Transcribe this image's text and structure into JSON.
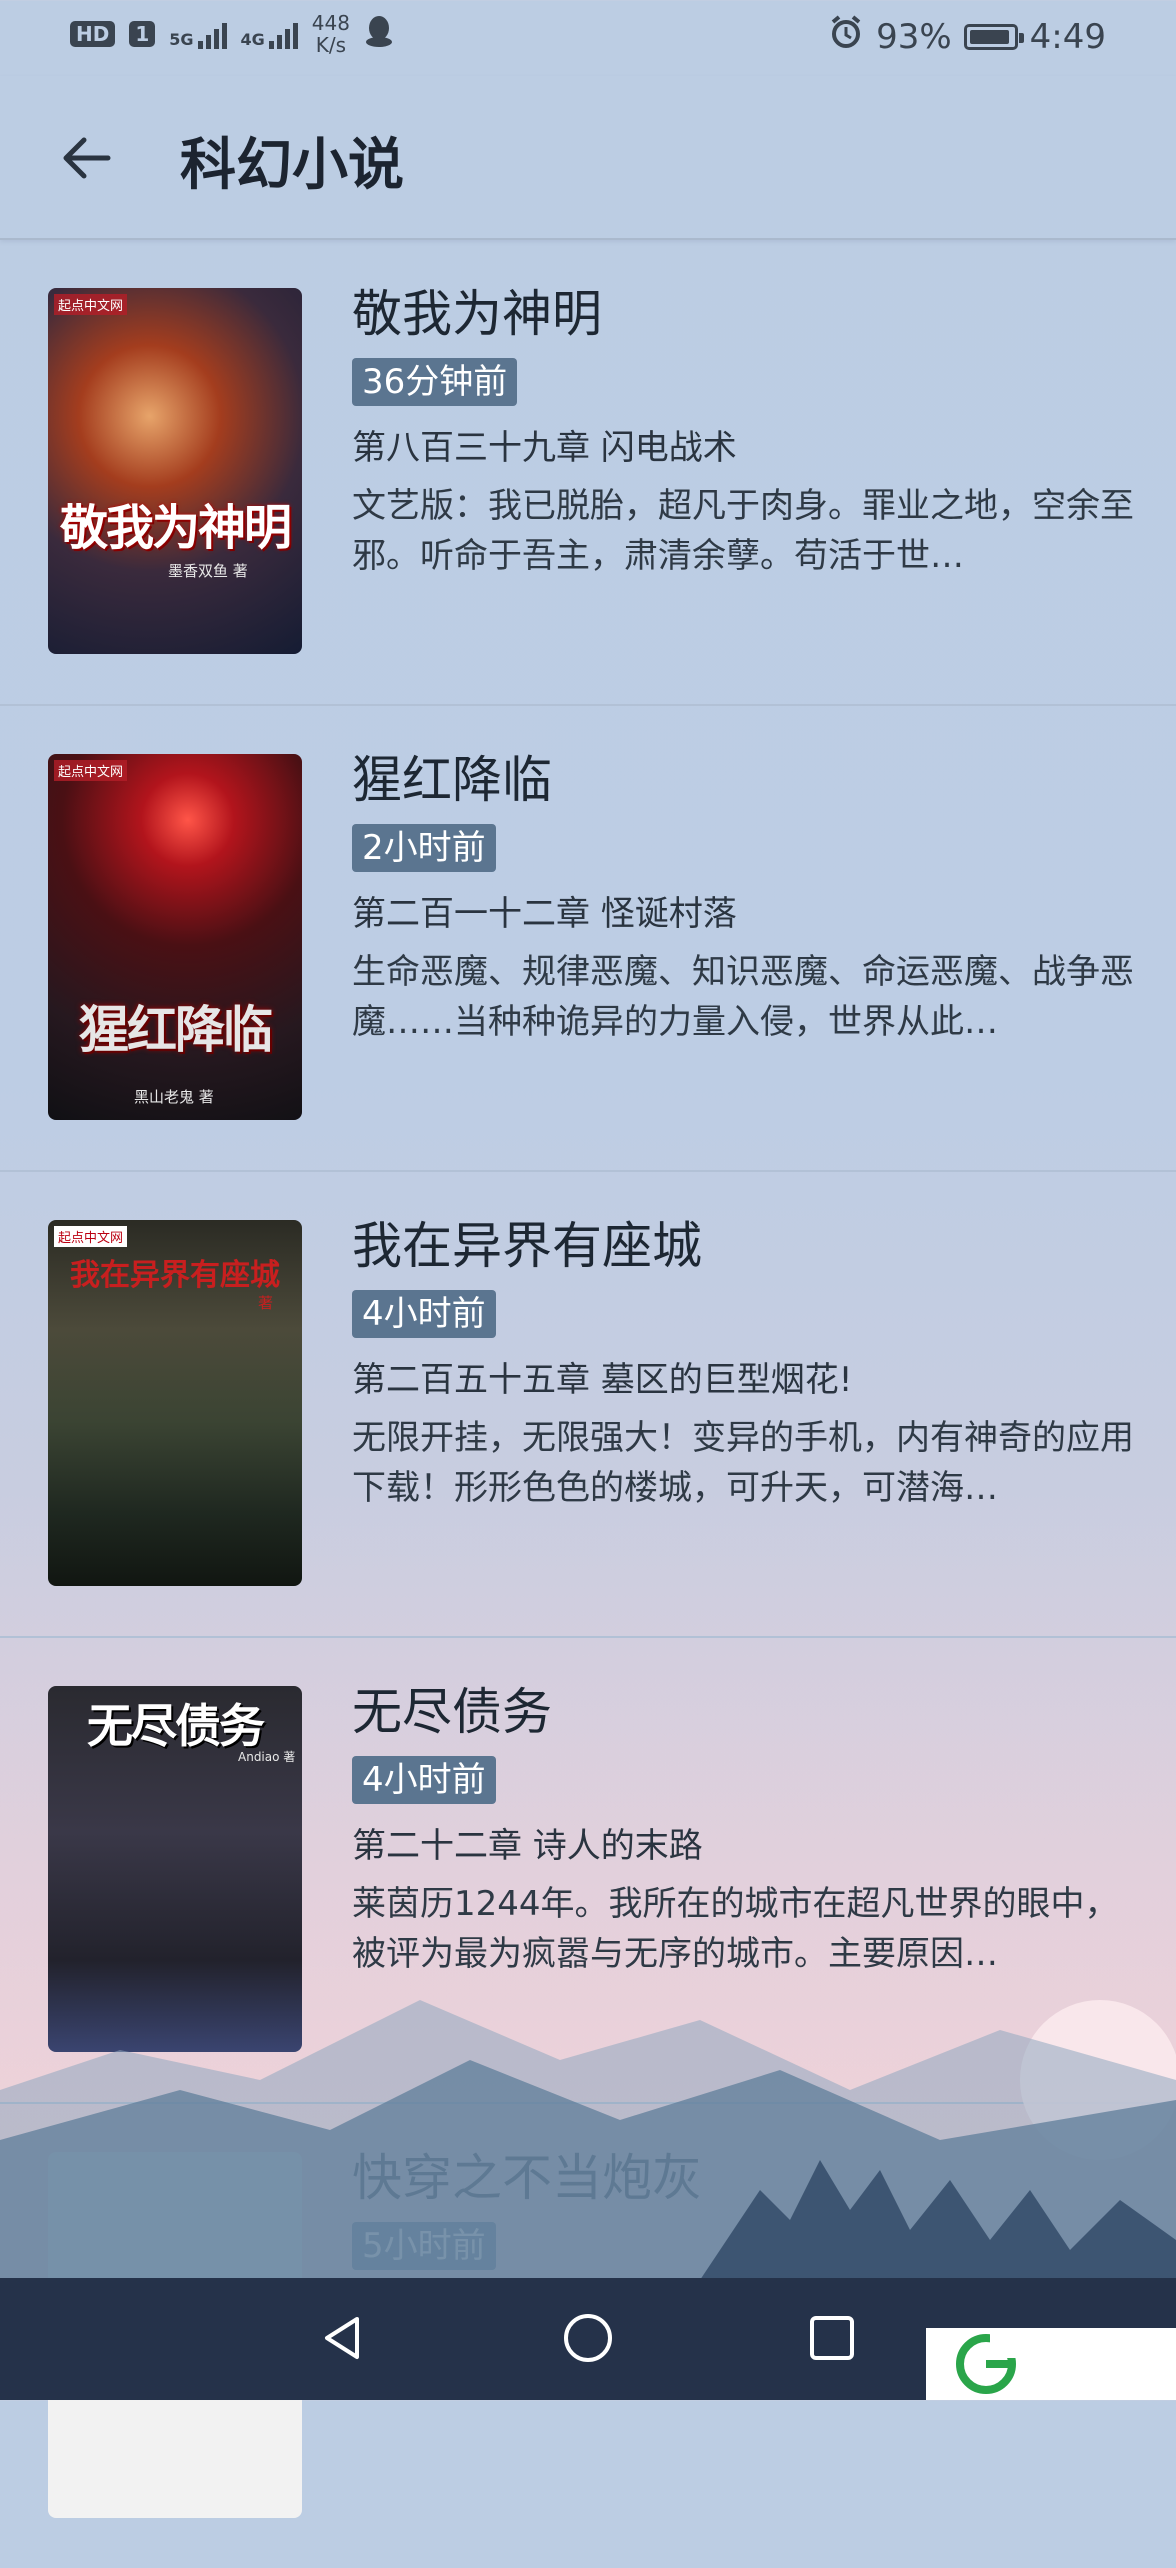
{
  "status": {
    "hd": "HD",
    "sim": "1",
    "sig1_label": "5G",
    "sig2_label": "4G",
    "net_speed": "448",
    "net_unit": "K/s",
    "battery": "93%",
    "battery_level": 0.93,
    "time": "4:49"
  },
  "header": {
    "title": "科幻小说",
    "back_icon": "back-arrow-icon"
  },
  "books": [
    {
      "name": "敬我为神明",
      "time": "36分钟前",
      "chapter": "第八百三十九章 闪电战术",
      "desc": "文艺版：我已脱胎，超凡于肉身。罪业之地，空余至邪。听命于吾主，肃清余孽。苟活于世…",
      "cover_title": "敬我为神明",
      "cover_author": "墨香双鱼 著",
      "cover_pub": "起点中文网"
    },
    {
      "name": "猩红降临",
      "time": "2小时前",
      "chapter": "第二百一十二章 怪诞村落",
      "desc": "生命恶魔、规律恶魔、知识恶魔、命运恶魔、战争恶魔……当种种诡异的力量入侵，世界从此…",
      "cover_title": "猩红降临",
      "cover_author": "黑山老鬼 著",
      "cover_pub": "起点中文网"
    },
    {
      "name": "我在异界有座城",
      "time": "4小时前",
      "chapter": "第二百五十五章 墓区的巨型烟花!",
      "desc": "无限开挂，无限强大！变异的手机，内有神奇的应用下载！形形色色的楼城，可升天，可潜海…",
      "cover_title": "我在异界有座城",
      "cover_author": "著",
      "cover_pub": "起点中文网"
    },
    {
      "name": "无尽债务",
      "time": "4小时前",
      "chapter": "第二十二章 诗人的末路",
      "desc": "莱茵历1244年。我所在的城市在超凡世界的眼中，被评为最为疯嚣与无序的城市。主要原因…",
      "cover_title": "无尽债务",
      "cover_author": "Andiao 著",
      "cover_pub": ""
    },
    {
      "name": "快穿之不当炮灰",
      "time": "5小时前",
      "chapter": "",
      "desc": "",
      "cover_title": "",
      "cover_author": "",
      "cover_pub": ""
    }
  ],
  "nav": {
    "back": "nav-back-icon",
    "home": "nav-home-icon",
    "recents": "nav-recents-icon"
  },
  "colors": {
    "badge": "#5b7590",
    "navbar": "#25324a",
    "background_top": "#bccde3",
    "background_bottom": "#f3dadf"
  }
}
